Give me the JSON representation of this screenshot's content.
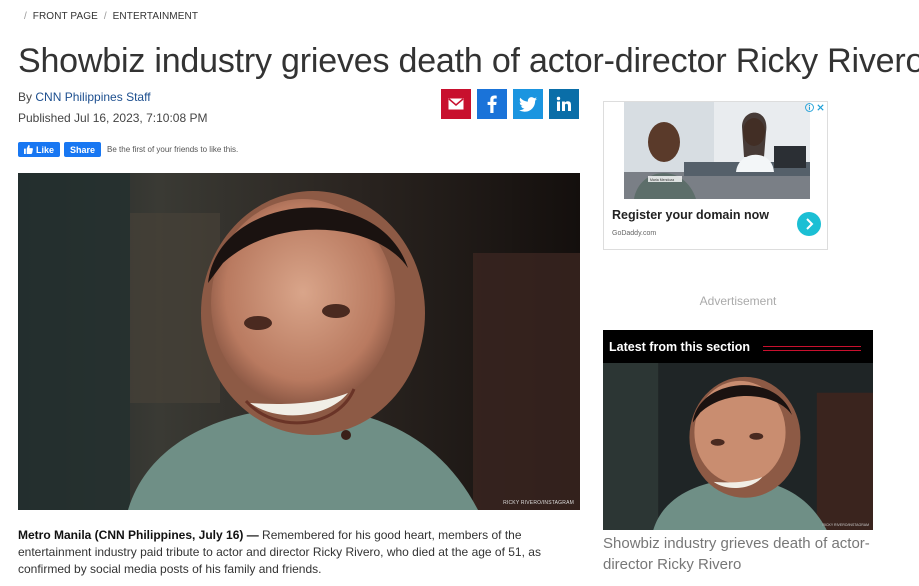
{
  "breadcrumb": {
    "items": [
      "FRONT PAGE",
      "ENTERTAINMENT"
    ]
  },
  "article": {
    "headline": "Showbiz industry grieves death of actor-director Ricky Rivero",
    "byline_prefix": "By",
    "byline_author": "CNN Philippines Staff",
    "published": "Published Jul 16, 2023, 7:10:08 PM",
    "photo_credit": "RICKY RIVERO/INSTAGRAM",
    "lead_bold": "Metro Manila (CNN Philippines, July 16) —",
    "lead_text": " Remembered for his good heart, members of the entertainment industry paid tribute to actor and director Ricky Rivero, who died at the age of 51, as confirmed by social media posts of his family and friends."
  },
  "share": {
    "icons": [
      "email-icon",
      "facebook-icon",
      "twitter-icon",
      "linkedin-icon"
    ]
  },
  "facebook": {
    "like_label": "Like",
    "share_label": "Share",
    "note": "Be the first of your friends to like this."
  },
  "ad": {
    "title": "Register your domain now",
    "url": "GoDaddy.com",
    "nameplate": "Maria Mendoza"
  },
  "advertisement_label": "Advertisement",
  "latest": {
    "title": "Latest from this section",
    "headline": "Showbiz industry grieves death of actor-director Ricky Rivero",
    "photo_credit": "RICKY RIVERO/INSTAGRAM"
  },
  "colors": {
    "accent": "#c8102e",
    "facebook": "#1a73d9",
    "twitter": "#1b95e0",
    "linkedin": "#0a6ea8",
    "ad_arrow": "#1bbfd4"
  }
}
